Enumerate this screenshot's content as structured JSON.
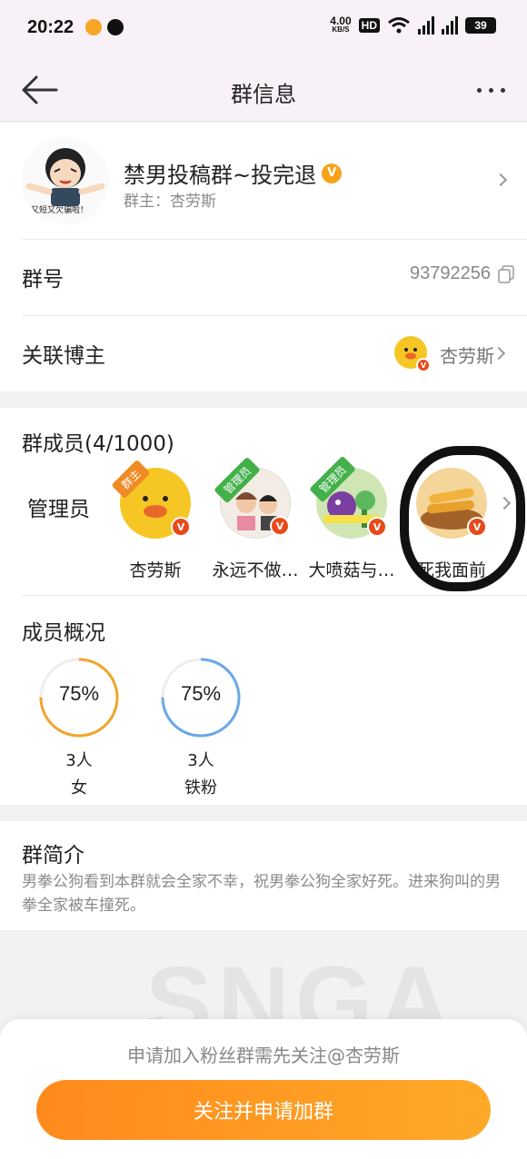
{
  "status_bar": {
    "time": "20:22",
    "speed_value": "4.00",
    "speed_unit": "KB/S",
    "hd": "HD",
    "battery": "39"
  },
  "nav": {
    "title": "群信息"
  },
  "group": {
    "name": "禁男投稿群~投完退",
    "owner": "群主：杏劳斯",
    "avatar_caption": "又短又欠骗啦！",
    "verified_icon": "v-badge-icon"
  },
  "group_id": {
    "label": "群号",
    "value": "93792256"
  },
  "blogger": {
    "label": "关联博主",
    "name": "杏劳斯"
  },
  "members": {
    "title": "群成员(4/1000)",
    "admin_label": "管理员",
    "list": [
      {
        "name": "杏劳斯",
        "ribbon": "群主"
      },
      {
        "name": "永远不做…",
        "ribbon": "管理员"
      },
      {
        "name": "大喷菇与…",
        "ribbon": "管理员"
      },
      {
        "name": "死我面前",
        "ribbon": ""
      }
    ]
  },
  "overview": {
    "title": "成员概况",
    "stats": [
      {
        "percent": "75%",
        "count": "3人",
        "label": "女",
        "value": 0.75,
        "color": "#f0a52a"
      },
      {
        "percent": "75%",
        "count": "3人",
        "label": "铁粉",
        "value": 0.75,
        "color": "#6aa8e6"
      }
    ]
  },
  "intro": {
    "title": "群简介",
    "text": "男拳公狗看到本群就会全家不幸，祝男拳公狗全家好死。进来狗叫的男拳全家被车撞死。"
  },
  "footer": {
    "hint": "申请加入粉丝群需先关注@杏劳斯",
    "button": "关注并申请加群"
  },
  "colors": {
    "accent": "#ff8a1c",
    "verified": "#f7a21b",
    "badge_red": "#e84a1a"
  }
}
